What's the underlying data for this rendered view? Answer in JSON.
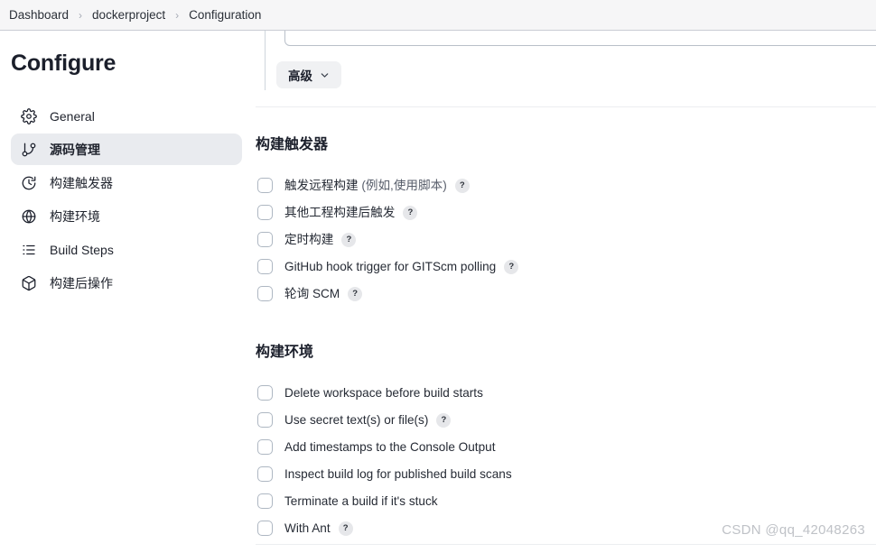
{
  "breadcrumb": {
    "items": [
      "Dashboard",
      "dockerproject",
      "Configuration"
    ],
    "separator": "›"
  },
  "sidebar": {
    "title": "Configure",
    "items": [
      {
        "label": "General",
        "icon": "gear-icon",
        "active": false
      },
      {
        "label": "源码管理",
        "icon": "git-branch-icon",
        "active": true
      },
      {
        "label": "构建触发器",
        "icon": "clock-icon",
        "active": false
      },
      {
        "label": "构建环境",
        "icon": "globe-icon",
        "active": false
      },
      {
        "label": "Build Steps",
        "icon": "list-icon",
        "active": false
      },
      {
        "label": "构建后操作",
        "icon": "package-icon",
        "active": false
      }
    ]
  },
  "main": {
    "advanced_button": {
      "label": "高级",
      "icon": "chevron-down-icon"
    },
    "help_glyph": "?",
    "sections": [
      {
        "id": "build-triggers",
        "title": "构建触发器",
        "options": [
          {
            "label": "触发远程构建 ",
            "label_dim": "(例如,使用脚本)",
            "help": true,
            "checked": false
          },
          {
            "label": "其他工程构建后触发",
            "label_dim": "",
            "help": true,
            "checked": false
          },
          {
            "label": "定时构建",
            "label_dim": "",
            "help": true,
            "checked": false
          },
          {
            "label": "GitHub hook trigger for GITScm polling",
            "label_dim": "",
            "help": true,
            "checked": false
          },
          {
            "label": "轮询 SCM",
            "label_dim": "",
            "help": true,
            "checked": false
          }
        ]
      },
      {
        "id": "build-environment",
        "title": "构建环境",
        "options": [
          {
            "label": "Delete workspace before build starts",
            "label_dim": "",
            "help": false,
            "checked": false
          },
          {
            "label": "Use secret text(s) or file(s)",
            "label_dim": "",
            "help": true,
            "checked": false
          },
          {
            "label": "Add timestamps to the Console Output",
            "label_dim": "",
            "help": false,
            "checked": false
          },
          {
            "label": "Inspect build log for published build scans",
            "label_dim": "",
            "help": false,
            "checked": false
          },
          {
            "label": "Terminate a build if it's stuck",
            "label_dim": "",
            "help": false,
            "checked": false
          },
          {
            "label": "With Ant",
            "label_dim": "",
            "help": true,
            "checked": false
          }
        ]
      }
    ]
  },
  "watermark": "CSDN @qq_42048263",
  "colors": {
    "topbar_bg": "#f6f6f7",
    "sidebar_active_bg": "#e9ebef",
    "button_bg": "#f0f1f3",
    "checkbox_border": "#aeb7c2",
    "help_bg": "#e6e7ea",
    "text": "#1f2430",
    "watermark": "#bfc2c7"
  }
}
